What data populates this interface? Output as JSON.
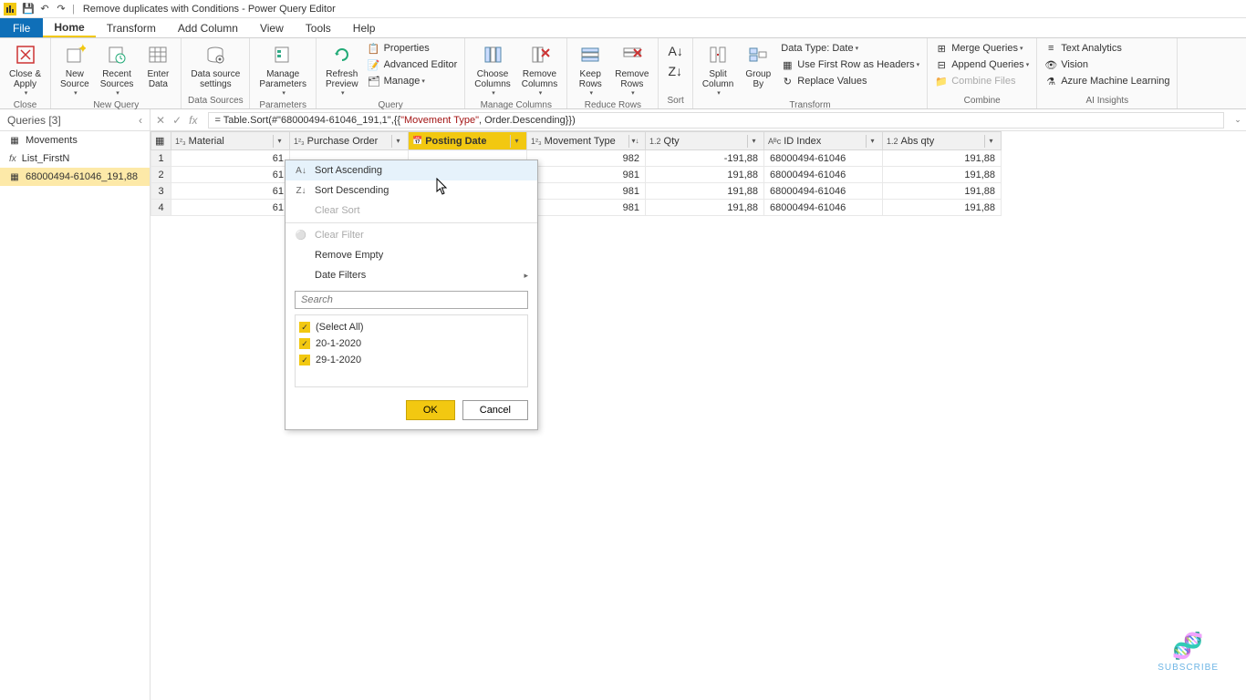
{
  "titlebar": {
    "title": "Remove duplicates with Conditions - Power Query Editor"
  },
  "menu": {
    "file": "File",
    "home": "Home",
    "transform": "Transform",
    "addcolumn": "Add Column",
    "view": "View",
    "tools": "Tools",
    "help": "Help"
  },
  "ribbon": {
    "close": {
      "close_apply": "Close &\nApply",
      "group": "Close"
    },
    "newquery": {
      "new_source": "New\nSource",
      "recent_sources": "Recent\nSources",
      "enter_data": "Enter\nData",
      "group": "New Query"
    },
    "datasources": {
      "settings": "Data source\nsettings",
      "group": "Data Sources"
    },
    "parameters": {
      "manage": "Manage\nParameters",
      "group": "Parameters"
    },
    "query": {
      "refresh": "Refresh\nPreview",
      "properties": "Properties",
      "advanced": "Advanced Editor",
      "manage": "Manage",
      "group": "Query"
    },
    "managecols": {
      "choose": "Choose\nColumns",
      "remove": "Remove\nColumns",
      "group": "Manage Columns"
    },
    "reducerows": {
      "keep": "Keep\nRows",
      "remove": "Remove\nRows",
      "group": "Reduce Rows"
    },
    "sort": {
      "group": "Sort"
    },
    "transform": {
      "split": "Split\nColumn",
      "groupby": "Group\nBy",
      "datatype": "Data Type: Date",
      "firstrow": "Use First Row as Headers",
      "replace": "Replace Values",
      "group": "Transform"
    },
    "combine": {
      "merge": "Merge Queries",
      "append": "Append Queries",
      "combinefiles": "Combine Files",
      "group": "Combine"
    },
    "ai": {
      "text": "Text Analytics",
      "vision": "Vision",
      "ml": "Azure Machine Learning",
      "group": "AI Insights"
    }
  },
  "queries": {
    "header": "Queries [3]",
    "items": [
      "Movements",
      "List_FirstN",
      "68000494-61046_191,88"
    ]
  },
  "formula": {
    "prefix": "= Table.Sort(#\"68000494-61046_191,1\",{{",
    "str": "\"Movement Type\"",
    "suffix": ", Order.Descending}})"
  },
  "columns": [
    "Material",
    "Purchase Order",
    "Posting Date",
    "Movement Type",
    "Qty",
    "ID Index",
    "Abs qty"
  ],
  "col_types": [
    "1²₃",
    "1²₃",
    "📅",
    "1²₃",
    "1.2",
    "Aᴮc",
    "1.2"
  ],
  "rows": [
    {
      "n": "1",
      "material": "61",
      "mtype": "982",
      "qty": "-191,88",
      "id": "68000494-61046",
      "abs": "191,88"
    },
    {
      "n": "2",
      "material": "61",
      "mtype": "981",
      "qty": "191,88",
      "id": "68000494-61046",
      "abs": "191,88"
    },
    {
      "n": "3",
      "material": "61",
      "mtype": "981",
      "qty": "191,88",
      "id": "68000494-61046",
      "abs": "191,88"
    },
    {
      "n": "4",
      "material": "61",
      "mtype": "981",
      "qty": "191,88",
      "id": "68000494-61046",
      "abs": "191,88"
    }
  ],
  "filter": {
    "sort_asc": "Sort Ascending",
    "sort_desc": "Sort Descending",
    "clear_sort": "Clear Sort",
    "clear_filter": "Clear Filter",
    "remove_empty": "Remove Empty",
    "date_filters": "Date Filters",
    "search_ph": "Search",
    "select_all": "(Select All)",
    "opt1": "20-1-2020",
    "opt2": "29-1-2020",
    "ok": "OK",
    "cancel": "Cancel"
  },
  "subscribe": "SUBSCRIBE"
}
